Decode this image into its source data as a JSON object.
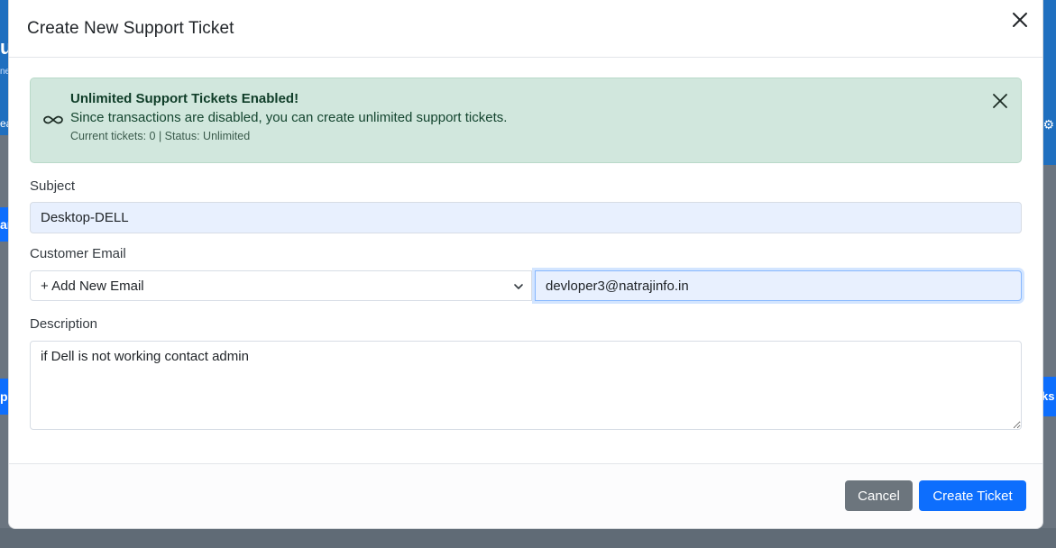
{
  "background": {
    "left_header_fragment": "u",
    "left_sub_fragment": "ne",
    "left_nav_fragment": "ea",
    "left_button_fragment": "ar",
    "left_button2_fragment": "p",
    "right_button_fragment": "ks"
  },
  "modal": {
    "title": "Create New Support Ticket"
  },
  "alert": {
    "title": "Unlimited Support Tickets Enabled!",
    "message": "Since transactions are disabled, you can create unlimited support tickets.",
    "meta": "Current tickets: 0 | Status: Unlimited",
    "color": "#d1e7dd"
  },
  "form": {
    "subject_label": "Subject",
    "subject_value": "Desktop-DELL",
    "email_label": "Customer Email",
    "email_select_value": "+ Add New Email",
    "email_value": "devloper3@natrajinfo.in",
    "description_label": "Description",
    "description_value": "if Dell is not working contact admin"
  },
  "footer": {
    "cancel_label": "Cancel",
    "create_label": "Create Ticket"
  },
  "colors": {
    "primary": "#0d6efd",
    "secondary": "#6c757d",
    "autofill": "#e8f0fe"
  }
}
